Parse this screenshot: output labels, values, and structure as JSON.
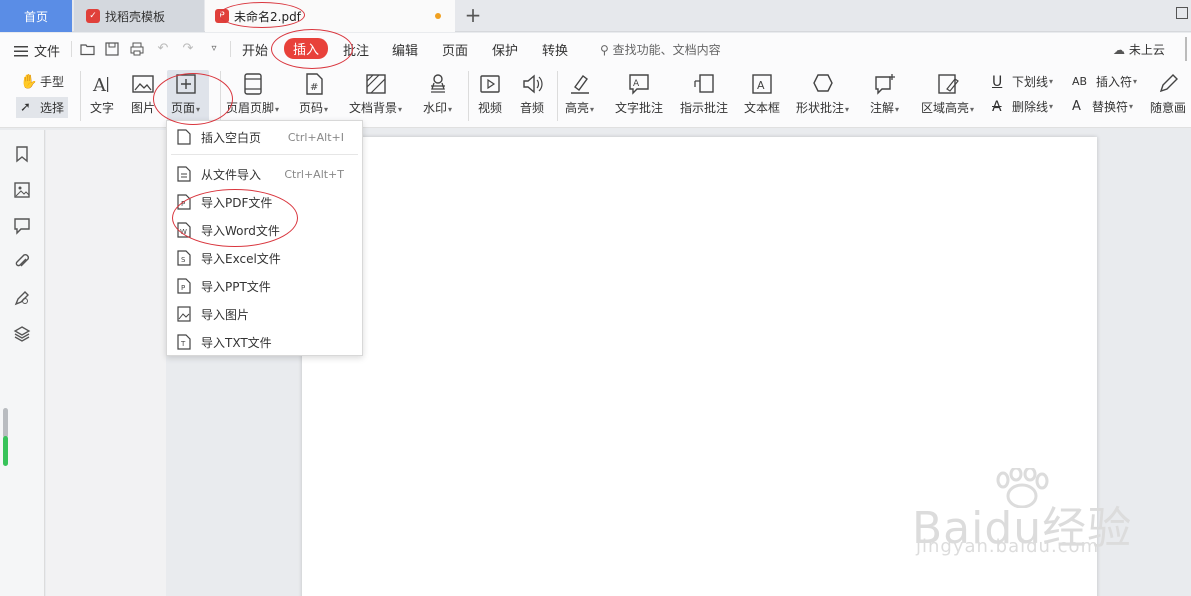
{
  "tabs": {
    "home": "首页",
    "template": "找稻壳模板",
    "document": "未命名2.pdf"
  },
  "menubar": {
    "file": "文件",
    "items": [
      "开始",
      "插入",
      "批注",
      "编辑",
      "页面",
      "保护",
      "转换"
    ],
    "active": "插入",
    "search_placeholder": "查找功能、文档内容",
    "cloud_status": "未上云"
  },
  "ribbon": {
    "hand": "手型",
    "select": "选择",
    "buttons": [
      "文字",
      "图片",
      "页面",
      "页眉页脚",
      "页码",
      "文档背景",
      "水印",
      "视频",
      "音频",
      "高亮",
      "文字批注",
      "指示批注",
      "文本框",
      "形状批注",
      "注解",
      "区域高亮"
    ],
    "small_buttons": [
      "下划线",
      "删除线",
      "插入符",
      "替换符"
    ],
    "last": "随意画"
  },
  "dropdown": {
    "items": [
      {
        "label": "插入空白页",
        "shortcut": "Ctrl+Alt+I"
      },
      {
        "label": "从文件导入",
        "shortcut": "Ctrl+Alt+T"
      },
      {
        "label": "导入PDF文件",
        "shortcut": ""
      },
      {
        "label": "导入Word文件",
        "shortcut": ""
      },
      {
        "label": "导入Excel文件",
        "shortcut": ""
      },
      {
        "label": "导入PPT文件",
        "shortcut": ""
      },
      {
        "label": "导入图片",
        "shortcut": ""
      },
      {
        "label": "导入TXT文件",
        "shortcut": ""
      }
    ]
  },
  "watermark": {
    "brand": "Baidu经验",
    "url": "jingyan.baidu.com"
  },
  "colors": {
    "accent_red": "#e8413a",
    "home_tab": "#5a8de6",
    "annotation": "#d9363e"
  }
}
